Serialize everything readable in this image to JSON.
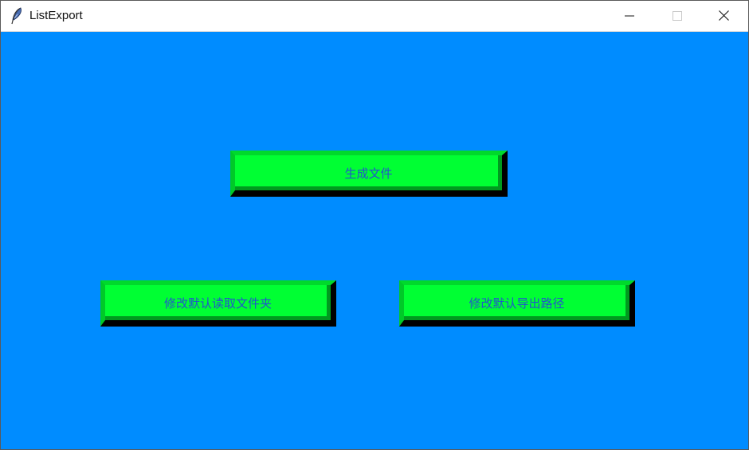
{
  "window": {
    "title": "ListExport",
    "app_icon": "feather-icon",
    "controls": {
      "minimize_icon": "minimize-icon",
      "maximize_icon": "maximize-icon",
      "close_icon": "close-icon"
    }
  },
  "colors": {
    "background": "#008cff",
    "button_face": "#00ff33",
    "button_text": "#2255cc"
  },
  "buttons": {
    "generate_label": "生成文件",
    "change_read_folder_label": "修改默认读取文件夹",
    "change_export_path_label": "修改默认导出路径"
  }
}
